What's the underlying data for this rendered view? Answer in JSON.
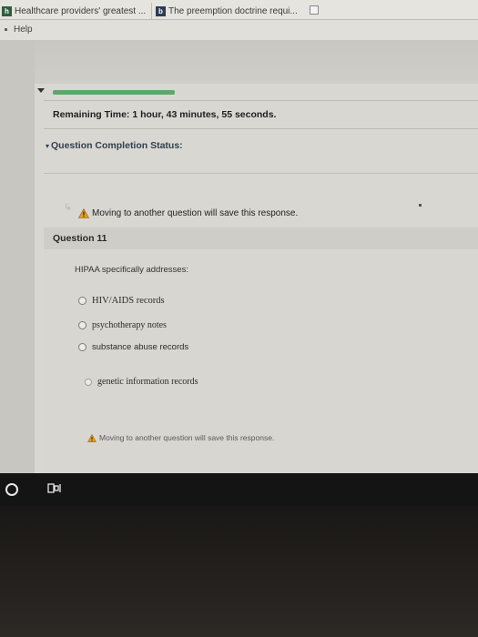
{
  "browser": {
    "tabs": [
      {
        "label": "Healthcare providers' greatest ...",
        "favicon": "h"
      },
      {
        "label": "The preemption doctrine requi...",
        "favicon": "b"
      }
    ],
    "menu": {
      "help_label": "Help"
    }
  },
  "test": {
    "remaining_time_label": "Remaining Time:",
    "remaining_time_value": "1 hour, 43 minutes, 55 seconds.",
    "completion_status_label": "Question Completion Status:",
    "progress_fraction": 0.28,
    "warning_top": "Moving to another question will save this response.",
    "question_title": "Question 11",
    "question_text": "HIPAA specifically addresses:",
    "options": [
      "HIV/AIDS records",
      "psychotherapy notes",
      "substance abuse records",
      "genetic information records"
    ],
    "warning_bottom": "Moving to another question will save this response."
  },
  "colors": {
    "progress": "#5aa86a",
    "warning_icon": "#e0a020",
    "screen_bg": "#d7d5cf",
    "taskbar": "#141414"
  },
  "icons": {
    "warning": "warning-triangle-icon",
    "cortana": "cortana-circle-icon",
    "taskview": "task-view-icon",
    "collapse": "chevron-down-icon"
  }
}
